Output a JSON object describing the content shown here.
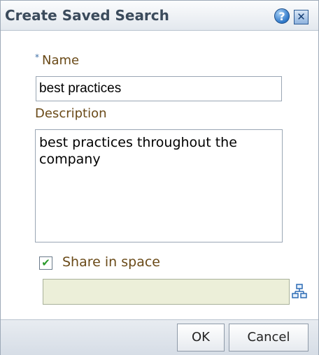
{
  "dialog": {
    "title": "Create Saved Search",
    "help_symbol": "?",
    "close_symbol": "✕"
  },
  "form": {
    "required_marker": "*",
    "name_label": "Name",
    "name_value": "best practices",
    "description_label": "Description",
    "description_value": "best practices throughout the company",
    "share_checked": true,
    "share_check_symbol": "✔",
    "share_label": "Share in space",
    "space_value": ""
  },
  "buttons": {
    "ok": "OK",
    "cancel": "Cancel"
  },
  "colors": {
    "label": "#6a4a18",
    "space_field_bg": "#ecefd9",
    "check": "#2b9a2b"
  }
}
